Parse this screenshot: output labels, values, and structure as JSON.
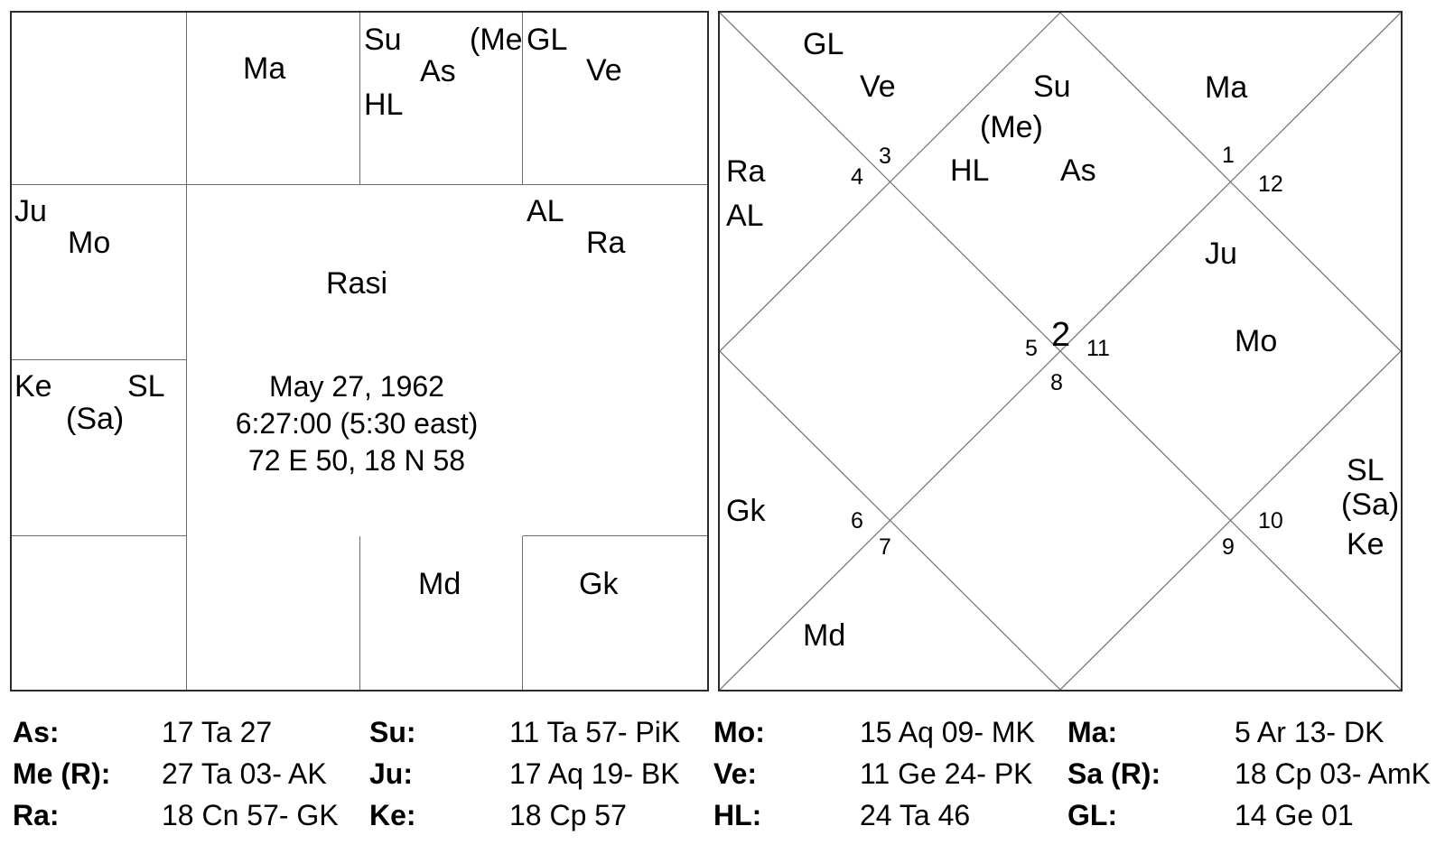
{
  "rasi_chart": {
    "title": "Rasi",
    "birth_details": "May 27, 1962\n6:27:00 (5:30 east)\n72 E 50, 18 N 58",
    "cells": [
      {
        "house": "r1c1",
        "glyphs": []
      },
      {
        "house": "r1c2",
        "glyphs": [
          "Ma"
        ]
      },
      {
        "house": "r1c3",
        "glyphs": [
          "Su",
          "As",
          "(Me",
          "HL"
        ]
      },
      {
        "house": "r1c4",
        "glyphs": [
          "GL",
          "Ve"
        ]
      },
      {
        "house": "r2c1",
        "glyphs": [
          "Ju",
          "Mo"
        ]
      },
      {
        "house": "r2c4",
        "glyphs": [
          "AL",
          "Ra"
        ]
      },
      {
        "house": "r3c1",
        "glyphs": [
          "Ke",
          "SL",
          "(Sa)"
        ]
      },
      {
        "house": "r3c4",
        "glyphs": []
      },
      {
        "house": "r4c1",
        "glyphs": []
      },
      {
        "house": "r4c2",
        "glyphs": []
      },
      {
        "house": "r4c3",
        "glyphs": [
          "Md"
        ]
      },
      {
        "house": "r4c4",
        "glyphs": [
          "Gk"
        ]
      }
    ],
    "labels": {
      "ma": "Ma",
      "su": "Su",
      "as": "As",
      "me_clipped": "(Me",
      "hl": "HL",
      "gl": "GL",
      "ve": "Ve",
      "ju": "Ju",
      "mo": "Mo",
      "al": "AL",
      "ra": "Ra",
      "ke": "Ke",
      "sl": "SL",
      "sa": "(Sa)",
      "md": "Md",
      "gk": "Gk"
    }
  },
  "north_chart": {
    "house_numbers": {
      "h1": "1",
      "h2": "2",
      "h3": "3",
      "h4": "4",
      "h5": "5",
      "h6": "6",
      "h7": "7",
      "h8": "8",
      "h9": "9",
      "h10": "10",
      "h11": "11",
      "h12": "12"
    },
    "labels": {
      "gl": "GL",
      "ve": "Ve",
      "su": "Su",
      "me": "(Me)",
      "ma": "Ma",
      "ra": "Ra",
      "al": "AL",
      "hl": "HL",
      "as": "As",
      "ju": "Ju",
      "mo": "Mo",
      "gk": "Gk",
      "md": "Md",
      "sl": "SL",
      "sa": "(Sa)",
      "ke": "Ke"
    }
  },
  "data_left": {
    "rows": [
      {
        "key_a": "As:",
        "val_a": "17 Ta 27",
        "key_b": "Su:",
        "val_b": "11 Ta 57- PiK"
      },
      {
        "key_a": "Me (R):",
        "val_a": "27 Ta 03- AK",
        "key_b": "Ju:",
        "val_b": "17 Aq 19- BK"
      },
      {
        "key_a": "Ra:",
        "val_a": "18 Cn 57- GK",
        "key_b": "Ke:",
        "val_b": "18 Cp 57"
      }
    ]
  },
  "data_right": {
    "rows": [
      {
        "key_a": "Mo:",
        "val_a": "15 Aq 09- MK",
        "key_b": "Ma:",
        "val_b": "5 Ar 13- DK"
      },
      {
        "key_a": "Ve:",
        "val_a": "11 Ge 24- PK",
        "key_b": "Sa (R):",
        "val_b": "18 Cp 03- AmK"
      },
      {
        "key_a": "HL:",
        "val_a": "24 Ta 46",
        "key_b": "GL:",
        "val_b": "14 Ge 01"
      }
    ]
  },
  "colors": {
    "outer_border": "#2b2b2b",
    "grid_line": "#6d6d6d",
    "diagonal_line": "#707070",
    "text": "#000000",
    "background": "#ffffff"
  }
}
